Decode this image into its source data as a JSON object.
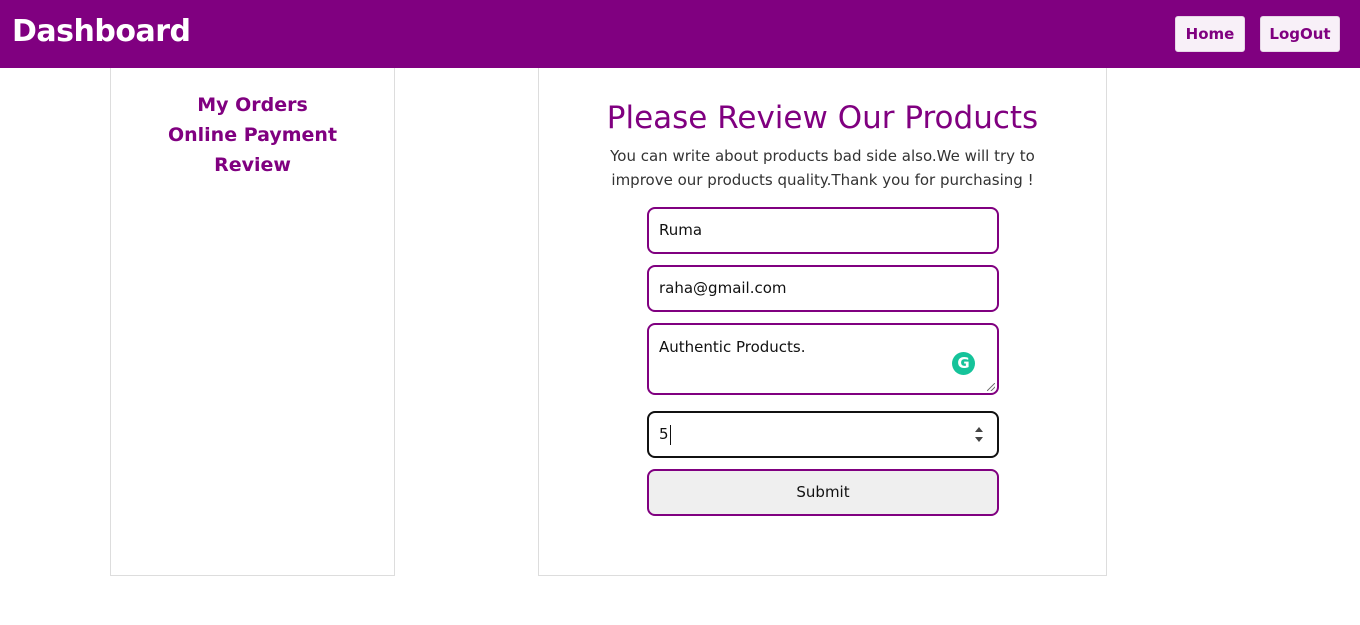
{
  "header": {
    "title": "Dashboard",
    "home_label": "Home",
    "logout_label": "LogOut"
  },
  "sidebar": {
    "items": [
      {
        "label": "My Orders"
      },
      {
        "label": "Online Payment"
      },
      {
        "label": "Review"
      }
    ]
  },
  "review": {
    "title": "Please Review Our Products",
    "description": "You can write about products bad side also.We will try to improve our products quality.Thank you for purchasing !",
    "name_value": "Ruma",
    "email_value": "raha@gmail.com",
    "comment_value": "Authentic Products.",
    "rating_value": "5",
    "submit_label": "Submit"
  },
  "icons": {
    "grammarly": "grammarly-icon",
    "grammarly_glyph": "G"
  },
  "colors": {
    "brand": "#800080",
    "grammarly": "#15c39a"
  }
}
